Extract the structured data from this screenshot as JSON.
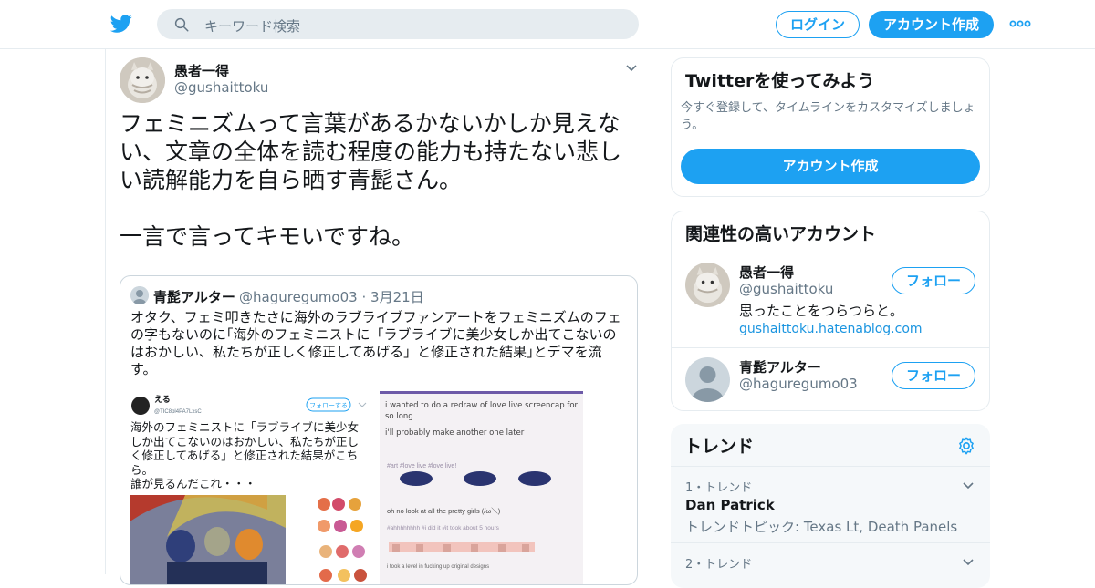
{
  "colors": {
    "accent": "#1da1f2",
    "text": "#14171a",
    "muted": "#657786",
    "border": "#e6ecf0"
  },
  "header": {
    "logo_icon": "twitter-bird-icon",
    "search_placeholder": "キーワード検索",
    "login_label": "ログイン",
    "signup_label": "アカウント作成",
    "more_icon": "more-dots-icon"
  },
  "tweet": {
    "author_name": "愚者一得",
    "author_handle": "@gushaittoku",
    "text_1": "フェミニズムって言葉があるかないかしか見えない、文章の全体を読む程度の能力も持たない悲しい読解能力を自ら晒す青髭さん。",
    "text_2": "一言で言ってキモいですね。",
    "quote": {
      "name": "青髭アルター",
      "handle": "@haguregumo03",
      "date": "3月21日",
      "text": "オタク、フェミ叩きたさに海外のラブライブファンアートをフェミニズムのフェの字もないのに｢海外のフェミニストに「ラブライブに美少女しか出てこないのはおかしい、私たちが正しく修正してあげる」と修正された結果｣とデマを流す。",
      "embedded_left": {
        "name": "える",
        "handle": "@TIC8pl4PA7LxsC",
        "follow_label": "フォローする",
        "text": "海外のフェミニストに「ラブライブに美少女しか出てこないのはおかしい、私たちが正しく修正してあげる」と修正された結果がこちら。\n誰が見るんだこれ・・・"
      },
      "embedded_right": {
        "line_1": "i wanted to do a redraw of love live screencap for so long",
        "line_2": "i'll probably make another one later",
        "tags_1": "#art  #love live  #love live!",
        "line_3": "oh no look at all the pretty girls (/ω＼)",
        "tags_2": "#ahhhhhhhh  #i did it  #it took about 5 hours",
        "line_4": "i took a level in fucking up original designs"
      }
    }
  },
  "sidebar": {
    "signup_card": {
      "title": "Twitterを使ってみよう",
      "subtitle": "今すぐ登録して、タイムラインをカスタマイズしましょう。",
      "button": "アカウント作成"
    },
    "related": {
      "title": "関連性の高いアカウント",
      "accounts": [
        {
          "name": "愚者一得",
          "handle": "@gushaittoku",
          "follow": "フォロー",
          "bio": "思ったことをつらつらと。",
          "link": "gushaittoku.hatenablog.com"
        },
        {
          "name": "青髭アルター",
          "handle": "@haguregumo03",
          "follow": "フォロー"
        }
      ]
    },
    "trends": {
      "title": "トレンド",
      "settings_icon": "gear-icon",
      "items": [
        {
          "meta": "1・トレンド",
          "name": "Dan Patrick",
          "topic": "トレンドトピック: Texas Lt, Death Panels"
        },
        {
          "meta": "2・トレンド"
        }
      ]
    }
  }
}
